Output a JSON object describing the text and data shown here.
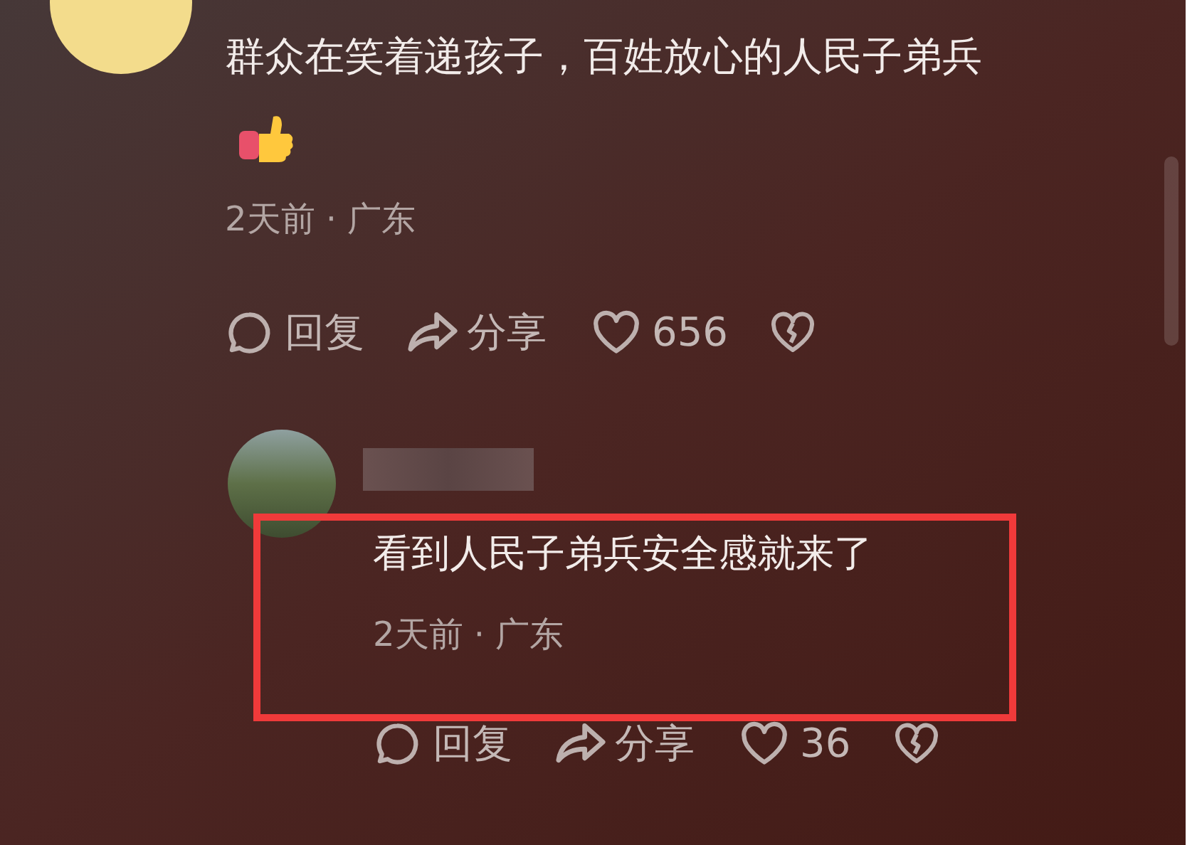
{
  "comments": [
    {
      "text": "群众在笑着递孩子，百姓放心的人民子弟兵",
      "meta": "2天前 · 广东",
      "reply": "回复",
      "share": "分享",
      "likes": "656",
      "highlighted": false
    },
    {
      "text": "看到人民子弟兵安全感就来了",
      "meta": "2天前 · 广东",
      "reply": "回复",
      "share": "分享",
      "likes": "36",
      "highlighted": true
    }
  ]
}
